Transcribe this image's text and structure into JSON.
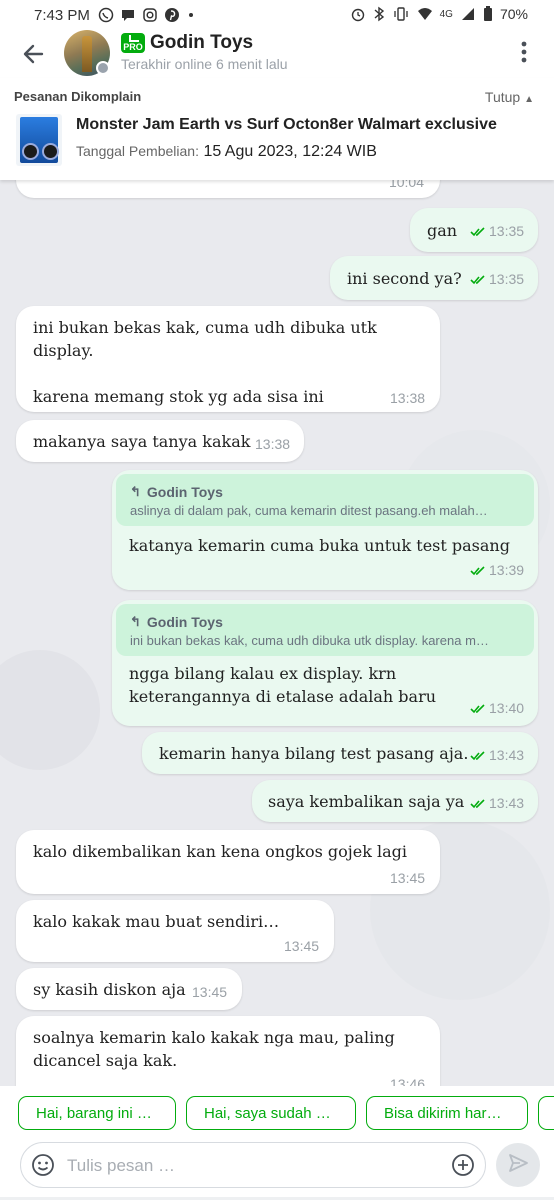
{
  "status_bar": {
    "time": "7:43 PM",
    "network": "4G",
    "battery": "70%"
  },
  "header": {
    "shop_name": "Godin Toys",
    "badge": "PRO",
    "last_online": "Terakhir online 6 menit lalu"
  },
  "complaint": {
    "label": "Pesanan Dikomplain",
    "toggle": "Tutup",
    "product_title": "Monster Jam Earth vs Surf Octon8er Walmart exclusive",
    "date_label": "Tanggal Pembelian:",
    "date_value": "15 Agu 2023, 12:24 WIB"
  },
  "messages": [
    {
      "dir": "in",
      "text": "",
      "time": "10:04"
    },
    {
      "dir": "out",
      "text": "gan",
      "time": "13:35",
      "read": true
    },
    {
      "dir": "out",
      "text": "ini second ya?",
      "time": "13:35",
      "read": true
    },
    {
      "dir": "in",
      "text": "ini bukan bekas kak, cuma udh dibuka utk display.\n\nkarena memang stok yg ada sisa ini",
      "time": "13:38"
    },
    {
      "dir": "in",
      "text": "makanya saya tanya kakak",
      "time": "13:38"
    },
    {
      "dir": "out",
      "reply_to": {
        "name": "Godin Toys",
        "text": "aslinya di dalam pak, cuma kemarin ditest pasang.eh malah…"
      },
      "text": "katanya kemarin cuma buka untuk test pasang",
      "time": "13:39",
      "read": true
    },
    {
      "dir": "out",
      "reply_to": {
        "name": "Godin Toys",
        "text": "ini bukan bekas kak, cuma udh dibuka utk display. karena m…"
      },
      "text": "ngga bilang kalau ex display. krn keterangannya di etalase adalah baru",
      "time": "13:40",
      "read": true
    },
    {
      "dir": "out",
      "text": "kemarin hanya bilang test pasang aja.",
      "time": "13:43",
      "read": true
    },
    {
      "dir": "out",
      "text": "saya kembalikan saja ya",
      "time": "13:43",
      "read": true
    },
    {
      "dir": "in",
      "text": "kalo dikembalikan kan kena ongkos gojek lagi",
      "time": "13:45"
    },
    {
      "dir": "in",
      "text": "kalo kakak mau buat sendiri…",
      "time": "13:45"
    },
    {
      "dir": "in",
      "text": "sy kasih diskon aja",
      "time": "13:45"
    },
    {
      "dir": "in",
      "text": "soalnya kemarin kalo kakak nga mau, paling dicancel saja kak.",
      "time": "13:46"
    }
  ],
  "quick_replies": [
    "Hai, barang ini …",
    "Hai, saya sudah …",
    "Bisa dikirim har…",
    ""
  ],
  "input": {
    "placeholder": "Tulis pesan …"
  },
  "colors": {
    "brand_green": "#03ac0e",
    "outgoing_bubble": "#eaf9f0",
    "reply_preview": "#cdf3db",
    "read_check": "#03ac0e"
  }
}
